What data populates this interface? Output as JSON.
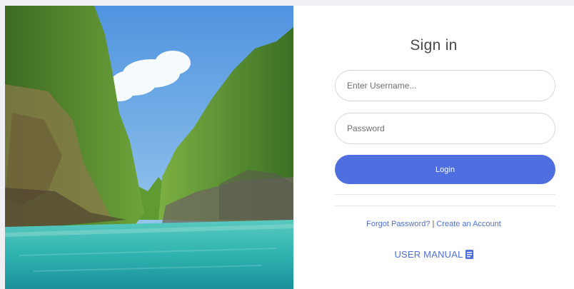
{
  "signin": {
    "title": "Sign in",
    "username_placeholder": "Enter Username...",
    "password_placeholder": "Password",
    "login_label": "Login",
    "forgot_label": "Forgot Password?",
    "separator": "|",
    "create_label": "Create an Account",
    "manual_label": "USER MANUAL",
    "manual_icon": "book-icon"
  },
  "colors": {
    "accent": "#4f6fe0",
    "water": "#2fb3b0",
    "sky": "#7ab4e6",
    "foliage": "#4f8a2e"
  },
  "photo": {
    "subject": "landscape-photo"
  }
}
